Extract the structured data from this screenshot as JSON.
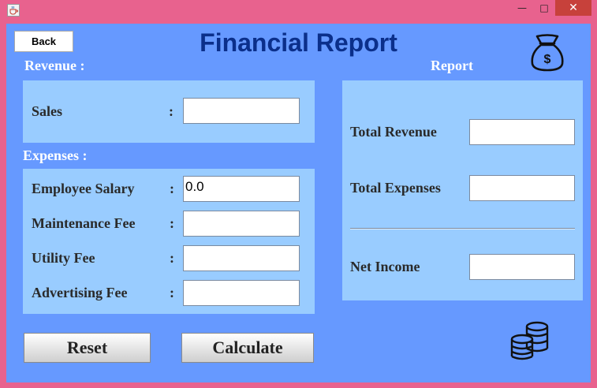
{
  "window": {
    "app_icon": "java-cup-icon",
    "minimize_symbol": "—",
    "maximize_symbol": "□",
    "close_symbol": "✕"
  },
  "header": {
    "back_label": "Back",
    "title": "Financial Report",
    "icon": "money-bag-icon"
  },
  "revenue": {
    "heading": "Revenue :",
    "sales_label": "Sales",
    "sales_colon": ":",
    "sales_value": ""
  },
  "expenses": {
    "heading": "Expenses :",
    "rows": [
      {
        "label": "Employee Salary",
        "colon": ":",
        "value": "0.0"
      },
      {
        "label": "Maintenance Fee",
        "colon": ":",
        "value": ""
      },
      {
        "label": "Utility Fee",
        "colon": ":",
        "value": ""
      },
      {
        "label": "Advertising Fee",
        "colon": ":",
        "value": ""
      }
    ]
  },
  "report": {
    "heading": "Report",
    "total_revenue_label": "Total Revenue",
    "total_revenue_value": "",
    "total_expenses_label": "Total Expenses",
    "total_expenses_value": "",
    "net_income_label": "Net Income",
    "net_income_value": ""
  },
  "actions": {
    "reset_label": "Reset",
    "calculate_label": "Calculate"
  },
  "decor": {
    "coins_icon": "coins-stack-icon"
  },
  "colors": {
    "window_frame": "#e8628e",
    "background": "#6699ff",
    "panel": "#99ccff",
    "title_text": "#0b2f8a"
  }
}
